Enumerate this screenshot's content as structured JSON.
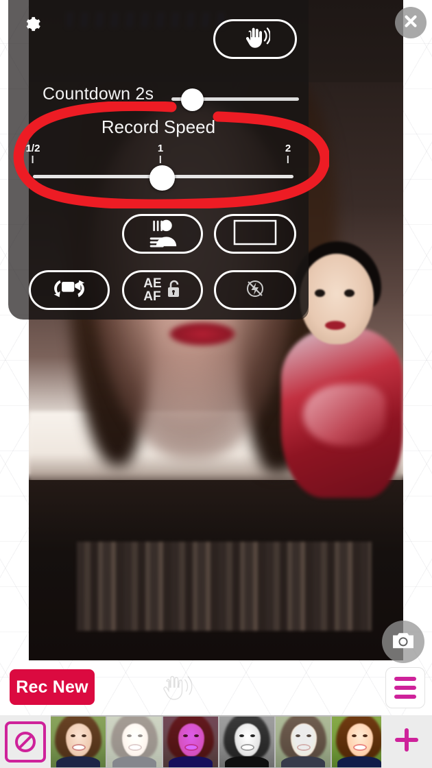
{
  "app": {
    "screen_name": "camera-settings-overlay"
  },
  "panel": {
    "gear_icon": "gear-icon",
    "wave_button": {
      "icon": "waving-hand-icon",
      "label": ""
    },
    "countdown": {
      "label": "Countdown 2s",
      "value": 2,
      "unit": "s",
      "slider_position_percent": 15
    },
    "record_speed": {
      "title": "Record Speed",
      "ticks": [
        "1/2",
        "1",
        "2"
      ],
      "tick_positions_percent": [
        0,
        50,
        100
      ],
      "value": "1",
      "slider_position_percent": 50
    },
    "buttons": [
      {
        "name": "background-blur-button",
        "icon": "person-blur-icon",
        "label": ""
      },
      {
        "name": "aspect-ratio-button",
        "icon": "rectangle-frame-icon",
        "label": ""
      },
      {
        "name": "flip-camera-button",
        "icon": "camera-flip-icon",
        "label": ""
      },
      {
        "name": "ae-af-lock-button",
        "icon": "padlock-unlocked-icon",
        "label_line1": "AE",
        "label_line2": "AF"
      },
      {
        "name": "flash-off-button",
        "icon": "flash-off-icon",
        "label": ""
      }
    ]
  },
  "close_button": {
    "icon": "close-x-icon",
    "label": ""
  },
  "shutter": {
    "icon": "camera-icon",
    "label": ""
  },
  "annotation": {
    "type": "hand-drawn-ellipse",
    "color": "#ED1C24",
    "target": "Record Speed"
  },
  "action_bar": {
    "record_button": {
      "label": "Rec New",
      "color": "#DB0A40"
    },
    "wave_hint_icon": "waving-hand-icon",
    "menu_button": {
      "icon": "hamburger-menu-icon",
      "color": "#CE229A"
    }
  },
  "filter_strip": {
    "no_filter_button": {
      "icon": "no-filter-icon",
      "color": "#CE229A"
    },
    "add_button": {
      "icon": "plus-icon",
      "color": "#CE229A",
      "label": "+"
    },
    "thumbnails": [
      {
        "name": "filter-normal",
        "style": "f-normal"
      },
      {
        "name": "filter-fade",
        "style": "f-fade"
      },
      {
        "name": "filter-purple",
        "style": "f-purple"
      },
      {
        "name": "filter-black-white",
        "style": "f-bw"
      },
      {
        "name": "filter-light",
        "style": "f-light"
      },
      {
        "name": "filter-warm",
        "style": "f-warm"
      }
    ]
  },
  "colors": {
    "accent_pink": "#CE229A",
    "record_red": "#DB0A40",
    "annotation_red": "#ED1C24",
    "panel_bg": "#231F1E"
  }
}
